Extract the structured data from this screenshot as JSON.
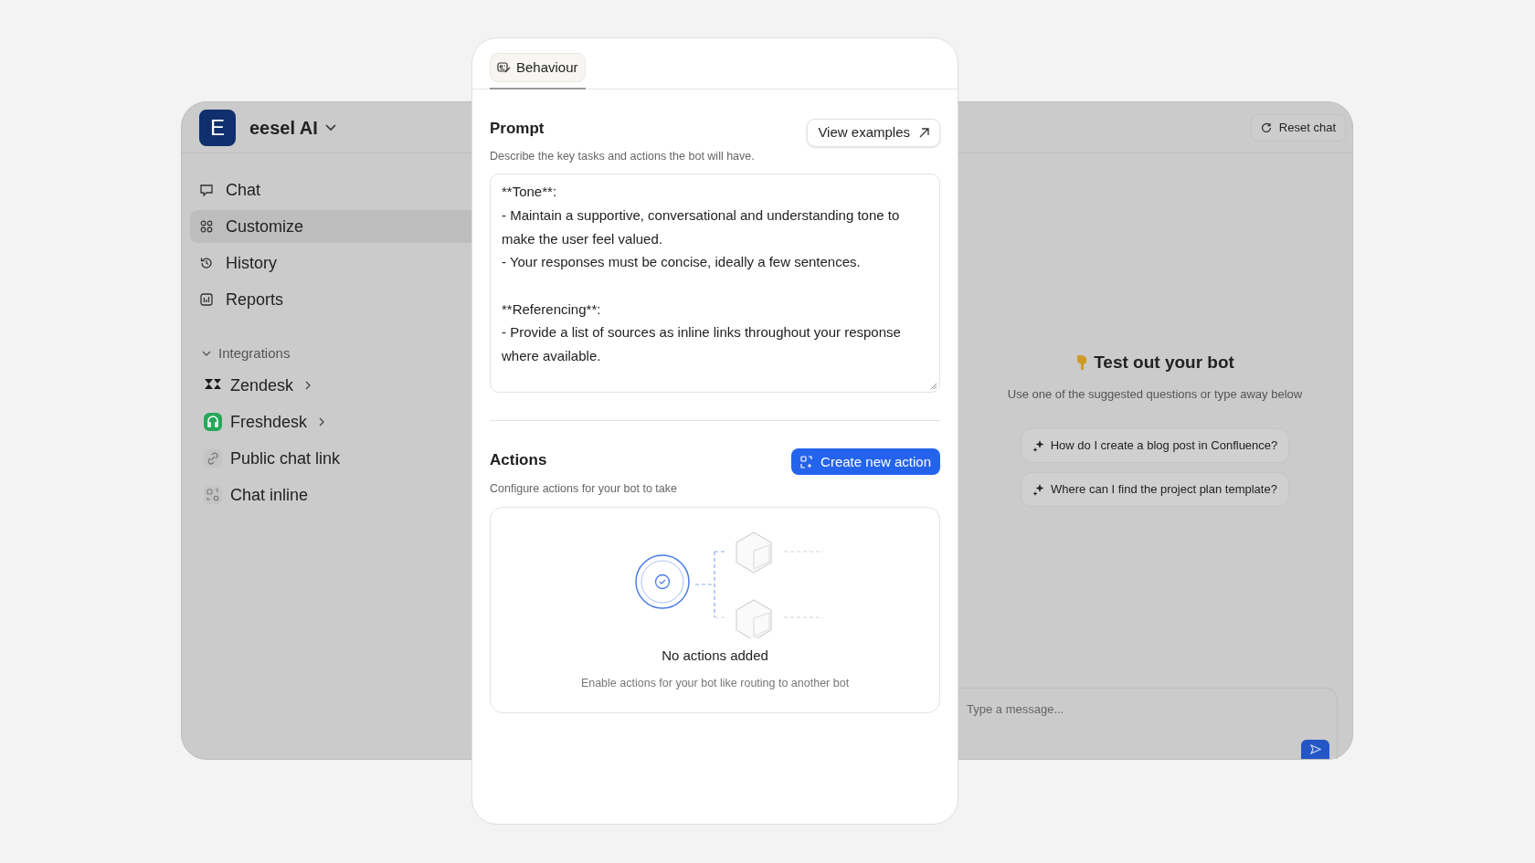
{
  "workspace": {
    "initial": "E",
    "name": "eesel AI"
  },
  "nav": [
    {
      "label": "Chat",
      "kind": "chat",
      "selected": false
    },
    {
      "label": "Customize",
      "kind": "customize",
      "selected": true
    },
    {
      "label": "History",
      "kind": "history",
      "selected": false
    },
    {
      "label": "Reports",
      "kind": "reports",
      "selected": false
    }
  ],
  "integrations": {
    "label": "Integrations",
    "expanded": true,
    "items": [
      {
        "label": "Zendesk",
        "kind": "zendesk",
        "has_submenu": true
      },
      {
        "label": "Freshdesk",
        "kind": "freshdesk",
        "has_submenu": true
      },
      {
        "label": "Public chat link",
        "kind": "link",
        "has_submenu": false
      },
      {
        "label": "Chat inline",
        "kind": "inline",
        "has_submenu": false
      }
    ]
  },
  "tabs": [
    {
      "label": "Behaviour",
      "selected": true
    }
  ],
  "prompt": {
    "title": "Prompt",
    "description": "Describe the key tasks and actions the bot will have.",
    "button": "View examples",
    "value": "**Tone**:\n- Maintain a supportive, conversational and understanding tone to make the user feel valued.\n- Your responses must be concise, ideally a few sentences.\n\n**Referencing**:\n- Provide a list of sources as inline links throughout your response where available."
  },
  "actions": {
    "title": "Actions",
    "description": "Configure actions for your bot to take",
    "button": "Create new action",
    "empty_title": "No actions added",
    "empty_text": "Enable actions for your bot like routing to another bot"
  },
  "chat": {
    "reset": "Reset chat",
    "title": "Test out your bot",
    "subtitle": "Use one of the suggested questions or type away below",
    "suggestions": [
      "How do I create a blog post in Confluence?",
      "Where can I find the project plan template?"
    ],
    "placeholder": "Type a message..."
  }
}
